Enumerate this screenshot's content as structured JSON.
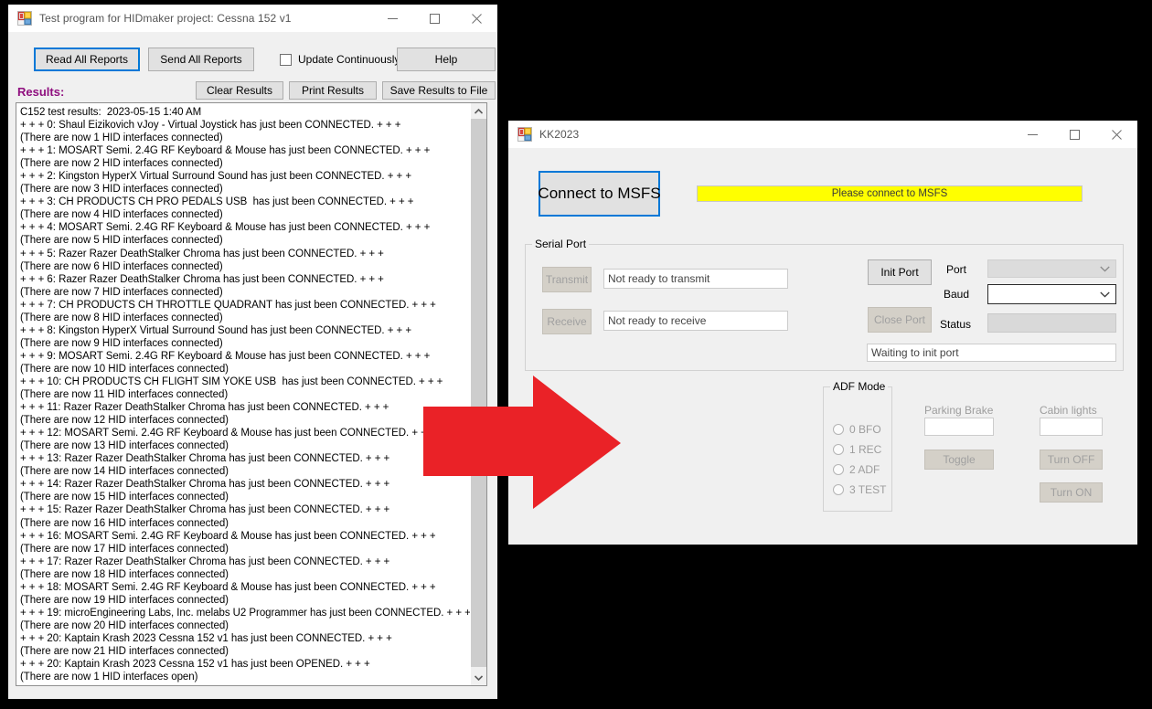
{
  "hidmaker_window": {
    "title": "Test program for HIDmaker project: Cessna 152 v1",
    "icon": "winforms-app-icon",
    "caption": {
      "minimize": "minimize-icon",
      "maximize": "maximize-icon",
      "close": "close-icon"
    },
    "toolbar": {
      "read_all_reports": "Read All Reports",
      "send_all_reports": "Send All Reports",
      "update_continuously": "Update Continuously",
      "help": "Help",
      "clear_results": "Clear Results",
      "print_results": "Print Results",
      "save_results_to_file": "Save Results to File"
    },
    "results_label": "Results:",
    "results_label_color": "#8f0f7f",
    "results_text": "C152 test results:  2023-05-15 1:40 AM\n+ + + 0: Shaul Eizikovich vJoy - Virtual Joystick has just been CONNECTED. + + +\n(There are now 1 HID interfaces connected)\n+ + + 1: MOSART Semi. 2.4G RF Keyboard & Mouse has just been CONNECTED. + + +\n(There are now 2 HID interfaces connected)\n+ + + 2: Kingston HyperX Virtual Surround Sound has just been CONNECTED. + + +\n(There are now 3 HID interfaces connected)\n+ + + 3: CH PRODUCTS CH PRO PEDALS USB  has just been CONNECTED. + + +\n(There are now 4 HID interfaces connected)\n+ + + 4: MOSART Semi. 2.4G RF Keyboard & Mouse has just been CONNECTED. + + +\n(There are now 5 HID interfaces connected)\n+ + + 5: Razer Razer DeathStalker Chroma has just been CONNECTED. + + +\n(There are now 6 HID interfaces connected)\n+ + + 6: Razer Razer DeathStalker Chroma has just been CONNECTED. + + +\n(There are now 7 HID interfaces connected)\n+ + + 7: CH PRODUCTS CH THROTTLE QUADRANT has just been CONNECTED. + + +\n(There are now 8 HID interfaces connected)\n+ + + 8: Kingston HyperX Virtual Surround Sound has just been CONNECTED. + + +\n(There are now 9 HID interfaces connected)\n+ + + 9: MOSART Semi. 2.4G RF Keyboard & Mouse has just been CONNECTED. + + +\n(There are now 10 HID interfaces connected)\n+ + + 10: CH PRODUCTS CH FLIGHT SIM YOKE USB  has just been CONNECTED. + + +\n(There are now 11 HID interfaces connected)\n+ + + 11: Razer Razer DeathStalker Chroma has just been CONNECTED. + + +\n(There are now 12 HID interfaces connected)\n+ + + 12: MOSART Semi. 2.4G RF Keyboard & Mouse has just been CONNECTED. + + +\n(There are now 13 HID interfaces connected)\n+ + + 13: Razer Razer DeathStalker Chroma has just been CONNECTED. + + +\n(There are now 14 HID interfaces connected)\n+ + + 14: Razer Razer DeathStalker Chroma has just been CONNECTED. + + +\n(There are now 15 HID interfaces connected)\n+ + + 15: Razer Razer DeathStalker Chroma has just been CONNECTED. + + +\n(There are now 16 HID interfaces connected)\n+ + + 16: MOSART Semi. 2.4G RF Keyboard & Mouse has just been CONNECTED. + + +\n(There are now 17 HID interfaces connected)\n+ + + 17: Razer Razer DeathStalker Chroma has just been CONNECTED. + + +\n(There are now 18 HID interfaces connected)\n+ + + 18: MOSART Semi. 2.4G RF Keyboard & Mouse has just been CONNECTED. + + +\n(There are now 19 HID interfaces connected)\n+ + + 19: microEngineering Labs, Inc. melabs U2 Programmer has just been CONNECTED. + + +\n(There are now 20 HID interfaces connected)\n+ + + 20: Kaptain Krash 2023 Cessna 152 v1 has just been CONNECTED. + + +\n(There are now 21 HID interfaces connected)\n+ + + 20: Kaptain Krash 2023 Cessna 152 v1 has just been OPENED. + + +\n(There are now 1 HID interfaces open)"
  },
  "kk2023_window": {
    "title": "KK2023",
    "icon": "winforms-app-icon",
    "connect_button": "Connect to MSFS",
    "status_banner": {
      "text": "Please connect to MSFS",
      "background": "#ffff00"
    },
    "serial_port": {
      "group_title": "Serial Port",
      "transmit_button": "Transmit",
      "transmit_status": "Not ready to transmit",
      "receive_button": "Receive",
      "receive_status": "Not ready to receive",
      "init_port_button": "Init Port",
      "close_port_button": "Close Port",
      "port_label": "Port",
      "port_value": "",
      "baud_label": "Baud",
      "baud_value": "",
      "status_label": "Status",
      "status_value": "",
      "port_message": "Waiting to init port"
    },
    "adf_mode": {
      "group_title": "ADF Mode",
      "options": [
        {
          "label": "0 BFO",
          "selected": false
        },
        {
          "label": "1 REC",
          "selected": false
        },
        {
          "label": "2 ADF",
          "selected": false
        },
        {
          "label": "3 TEST",
          "selected": false
        }
      ]
    },
    "parking_brake": {
      "label": "Parking Brake",
      "value": "",
      "toggle_button": "Toggle"
    },
    "cabin_lights": {
      "label": "Cabin lights",
      "value": "",
      "turn_off_button": "Turn OFF",
      "turn_on_button": "Turn ON"
    }
  },
  "annotation": {
    "arrow": "red-right-arrow",
    "color": "#ea2227"
  }
}
